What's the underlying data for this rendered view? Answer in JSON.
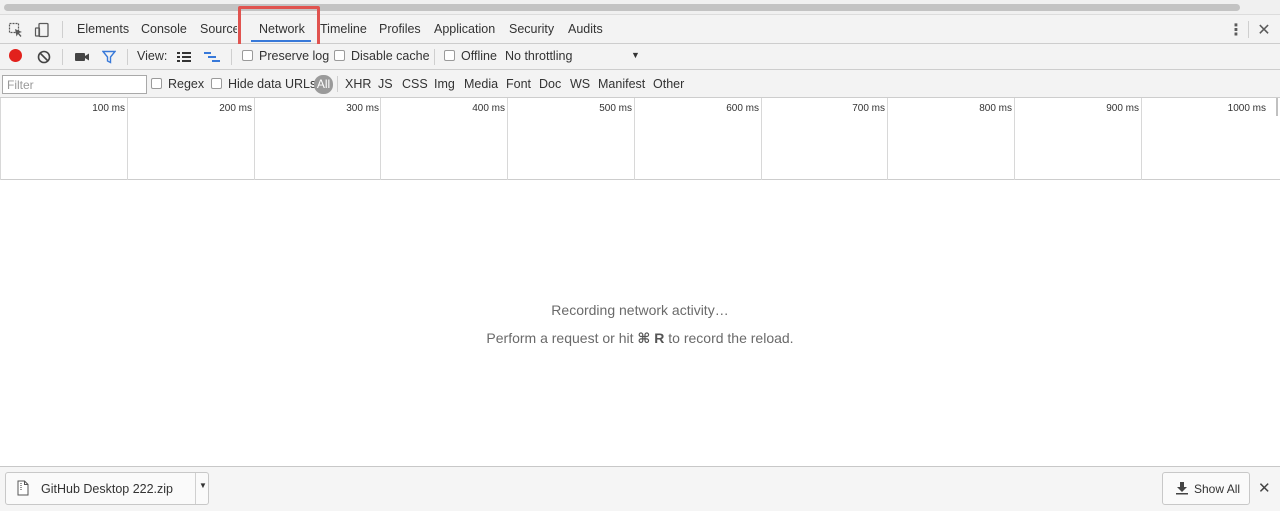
{
  "tabs": [
    {
      "label": "Elements"
    },
    {
      "label": "Console"
    },
    {
      "label": "Sources"
    },
    {
      "label": "Network"
    },
    {
      "label": "Timeline"
    },
    {
      "label": "Profiles"
    },
    {
      "label": "Application"
    },
    {
      "label": "Security"
    },
    {
      "label": "Audits"
    }
  ],
  "selected_tab": "Network",
  "toolbar": {
    "view_label": "View:",
    "preserve_log": "Preserve log",
    "disable_cache": "Disable cache",
    "offline": "Offline",
    "throttling": "No throttling"
  },
  "filterbar": {
    "filter_placeholder": "Filter",
    "regex": "Regex",
    "hide_data_urls": "Hide data URLs",
    "types": [
      "All",
      "XHR",
      "JS",
      "CSS",
      "Img",
      "Media",
      "Font",
      "Doc",
      "WS",
      "Manifest",
      "Other"
    ]
  },
  "timeline": {
    "ticks": [
      "100 ms",
      "200 ms",
      "300 ms",
      "400 ms",
      "500 ms",
      "600 ms",
      "700 ms",
      "800 ms",
      "900 ms",
      "1000 ms"
    ]
  },
  "empty_state": {
    "line1": "Recording network activity…",
    "line2_prefix": "Perform a request or hit ",
    "line2_shortcut": "⌘ R",
    "line2_suffix": " to record the reload."
  },
  "downloads": {
    "file_name": "GitHub Desktop 222.zip",
    "show_all": "Show All"
  },
  "colors": {
    "record": "#e2211c",
    "highlight": "#e0534f",
    "accent": "#3879d9"
  }
}
